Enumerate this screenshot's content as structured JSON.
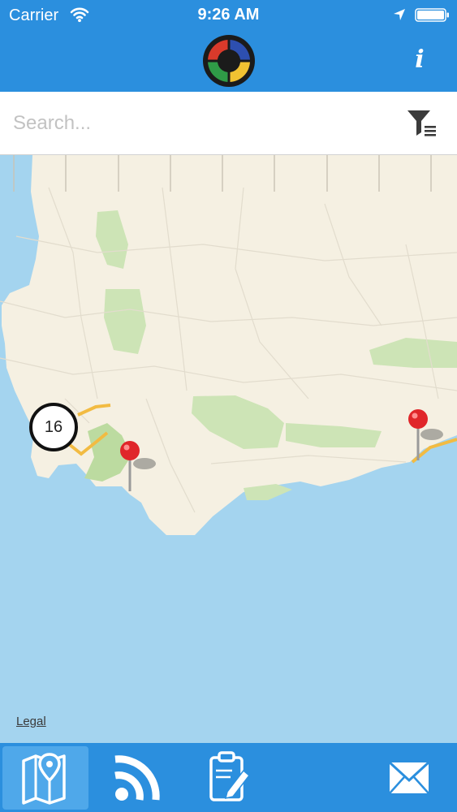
{
  "status_bar": {
    "carrier": "Carrier",
    "time": "9:26 AM",
    "icons": [
      "wifi-icon",
      "location-arrow-icon",
      "battery-icon"
    ]
  },
  "nav_bar": {
    "logo_icon": "app-logo-icon",
    "info_label": "i"
  },
  "search": {
    "placeholder": "Search...",
    "value": "",
    "filter_icon": "filter-icon"
  },
  "map": {
    "cluster_count": "16",
    "pin_count": 2,
    "legal_label": "Legal"
  },
  "tab_bar": {
    "tabs": [
      {
        "name": "map",
        "icon": "map-pin-icon",
        "selected": true
      },
      {
        "name": "feed",
        "icon": "rss-icon",
        "selected": false
      },
      {
        "name": "report",
        "icon": "clipboard-edit-icon",
        "selected": false
      },
      {
        "name": "contact",
        "icon": "mail-icon",
        "selected": false
      }
    ]
  },
  "colors": {
    "accent": "#2b8fde",
    "accent_selected": "#4fa8ea",
    "land": "#f5f0e2",
    "water": "#a4d4ef",
    "park": "#cde4b6",
    "road": "#f2bb42",
    "pin": "#e0262a"
  }
}
